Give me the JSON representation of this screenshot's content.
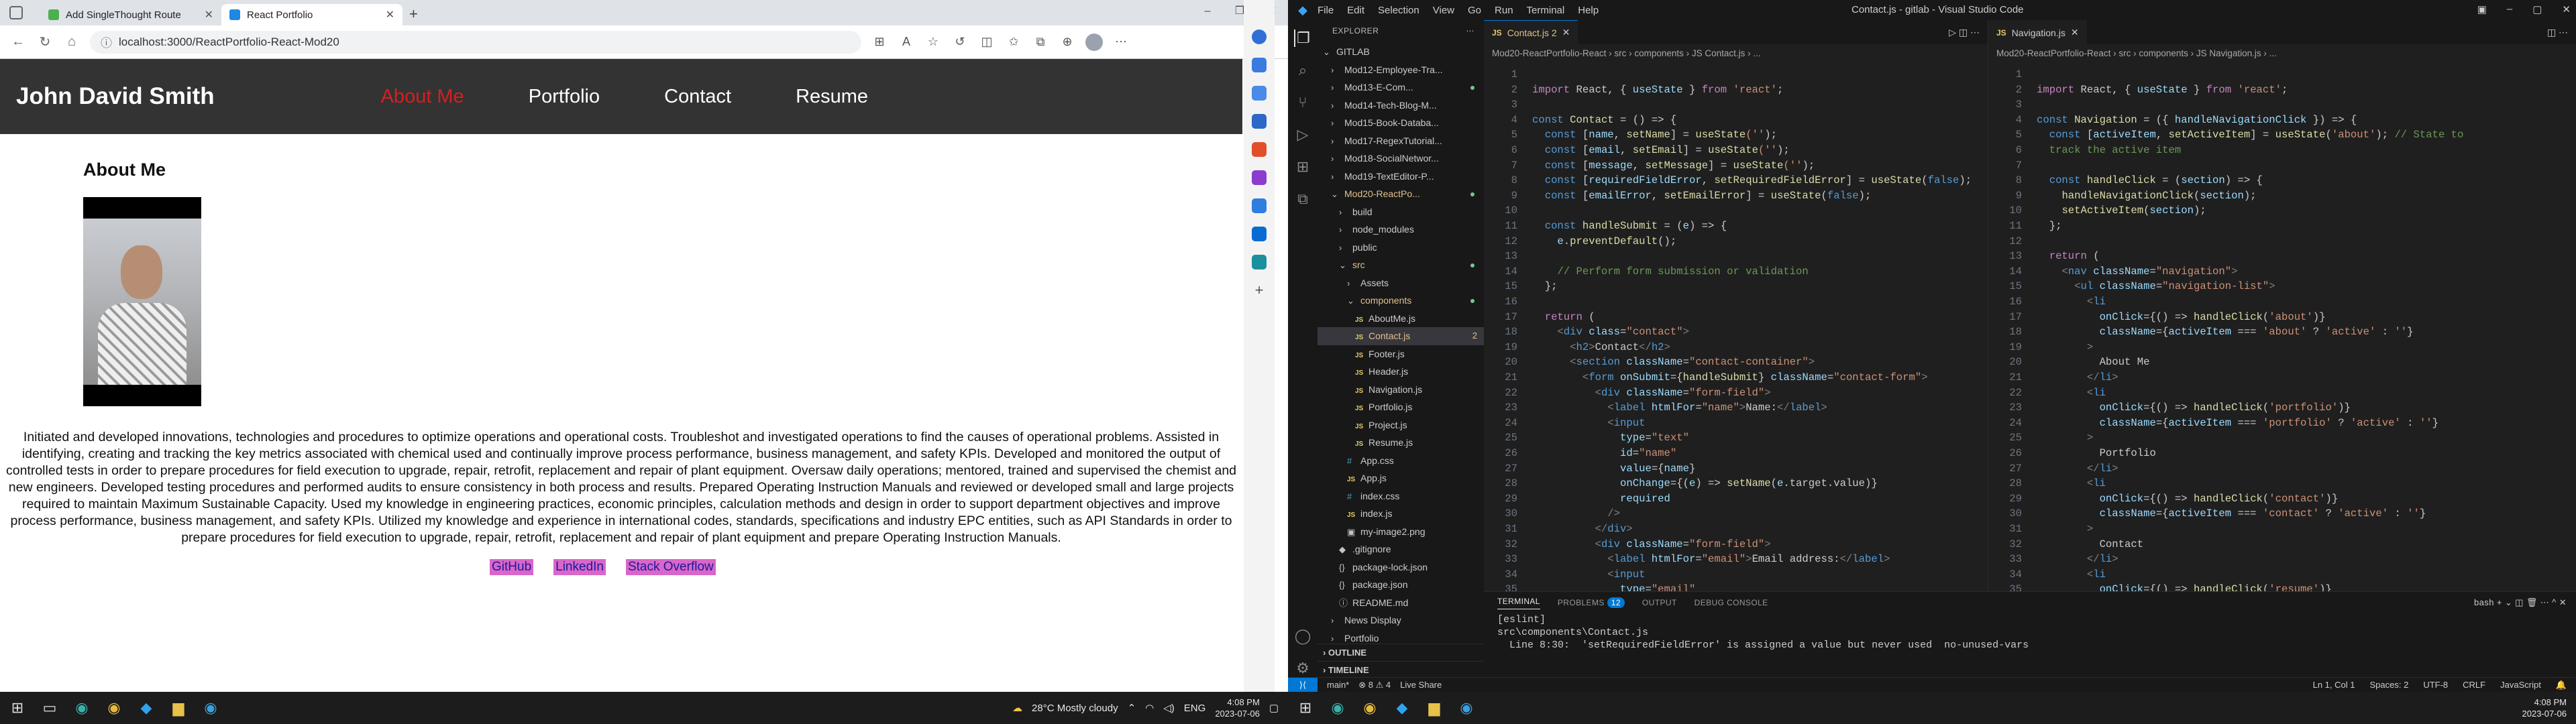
{
  "browser": {
    "tabs": [
      {
        "title": "Add SingleThought Route",
        "favicon_color": "#4caf50"
      },
      {
        "title": "React Portfolio",
        "favicon_color": "#1e88e5"
      }
    ],
    "new_tab": "+",
    "url": "localhost:3000/ReactPortfolio-React-Mod20",
    "win_controls": [
      "–",
      "❐",
      "✕"
    ]
  },
  "site": {
    "name": "John David Smith",
    "nav": [
      "About Me",
      "Portfolio",
      "Contact",
      "Resume"
    ],
    "active_nav": "About Me",
    "section_title": "About Me",
    "bio": "Initiated and developed innovations, technologies and procedures to optimize operations and operational costs. Troubleshot and investigated operations to find the causes of operational problems. Assisted in identifying, creating and tracking the key metrics associated with chemical used and continually improve process performance, business management, and safety KPIs. Developed and monitored the output of controlled tests in order to prepare procedures for field execution to upgrade, repair, retrofit, replacement and repair of plant equipment. Oversaw daily operations; mentored, trained and supervised the chemist and new engineers. Developed testing procedures and performed audits to ensure consistency in both process and results. Prepared Operating Instruction Manuals and reviewed or developed small and large projects required to maintain Maximum Sustainable Capacity. Used my knowledge in engineering practices, economic principles, calculation methods and design in order to support department objectives and improve process performance, business management, and safety KPIs. Utilized my knowledge and experience in international codes, standards, specifications and industry EPC entities, such as API Standards in order to prepare procedures for field execution to upgrade, repair, retrofit, replacement and repair of plant equipment and prepare Operating Instruction Manuals.",
    "links": [
      "GitHub",
      "LinkedIn",
      "Stack Overflow"
    ],
    "link_bg": "#d966c9",
    "nav_active_color": "#d61f1f"
  },
  "taskbar_left": {
    "weather": "28°C  Mostly cloudy",
    "lang": "ENG",
    "time": "4:08 PM",
    "date": "2023-07-06"
  },
  "vscode": {
    "window_title": "Contact.js - gitlab - Visual Studio Code",
    "menu": [
      "File",
      "Edit",
      "Selection",
      "View",
      "Go",
      "Run",
      "Terminal",
      "Help"
    ],
    "explorer_title": "EXPLORER",
    "tree": [
      {
        "label": "GITLAB",
        "indent": 0,
        "arrow": "⌄"
      },
      {
        "label": "Mod12-Employee-Tra...",
        "indent": 1,
        "arrow": "›"
      },
      {
        "label": "Mod13-E-Com...",
        "indent": 1,
        "arrow": "›",
        "dot": true
      },
      {
        "label": "Mod14-Tech-Blog-M...",
        "indent": 1,
        "arrow": "›"
      },
      {
        "label": "Mod15-Book-Databa...",
        "indent": 1,
        "arrow": "›"
      },
      {
        "label": "Mod17-RegexTutorial...",
        "indent": 1,
        "arrow": "›"
      },
      {
        "label": "Mod18-SocialNetwor...",
        "indent": 1,
        "arrow": "›"
      },
      {
        "label": "Mod19-TextEditor-P...",
        "indent": 1,
        "arrow": "›"
      },
      {
        "label": "Mod20-ReactPo...",
        "indent": 1,
        "arrow": "⌄",
        "mod": true,
        "dot": true
      },
      {
        "label": "build",
        "indent": 2,
        "arrow": "›"
      },
      {
        "label": "node_modules",
        "indent": 2,
        "arrow": "›"
      },
      {
        "label": "public",
        "indent": 2,
        "arrow": "›"
      },
      {
        "label": "src",
        "indent": 2,
        "arrow": "⌄",
        "mod": true,
        "dot": true
      },
      {
        "label": "Assets",
        "indent": 3,
        "arrow": "›"
      },
      {
        "label": "components",
        "indent": 3,
        "arrow": "⌄",
        "mod": true,
        "dot": true
      },
      {
        "label": "AboutMe.js",
        "indent": 4,
        "icon": "JS"
      },
      {
        "label": "Contact.js",
        "indent": 4,
        "icon": "JS",
        "sel": true,
        "mod": true,
        "badge": "2"
      },
      {
        "label": "Footer.js",
        "indent": 4,
        "icon": "JS"
      },
      {
        "label": "Header.js",
        "indent": 4,
        "icon": "JS"
      },
      {
        "label": "Navigation.js",
        "indent": 4,
        "icon": "JS"
      },
      {
        "label": "Portfolio.js",
        "indent": 4,
        "icon": "JS"
      },
      {
        "label": "Project.js",
        "indent": 4,
        "icon": "JS"
      },
      {
        "label": "Resume.js",
        "indent": 4,
        "icon": "JS"
      },
      {
        "label": "App.css",
        "indent": 3,
        "icon": "#"
      },
      {
        "label": "App.js",
        "indent": 3,
        "icon": "JS"
      },
      {
        "label": "index.css",
        "indent": 3,
        "icon": "#"
      },
      {
        "label": "index.js",
        "indent": 3,
        "icon": "JS"
      },
      {
        "label": "my-image2.png",
        "indent": 3,
        "icon": "▣"
      },
      {
        "label": ".gitignore",
        "indent": 2,
        "icon": "◆"
      },
      {
        "label": "package-lock.json",
        "indent": 2,
        "icon": "{}"
      },
      {
        "label": "package.json",
        "indent": 2,
        "icon": "{}"
      },
      {
        "label": "README.md",
        "indent": 2,
        "icon": "ⓘ"
      },
      {
        "label": "News Display",
        "indent": 1,
        "arrow": "›"
      },
      {
        "label": "Portfolio",
        "indent": 1,
        "arrow": "›"
      }
    ],
    "outline_label": "OUTLINE",
    "timeline_label": "TIMELINE",
    "editor1": {
      "tab": "Contact.js 2",
      "crumb": "Mod20-ReactPortfolio-React › src › components › JS Contact.js › ..."
    },
    "editor2": {
      "tab": "Navigation.js",
      "crumb": "Mod20-ReactPortfolio-React › src › components › JS Navigation.js › ..."
    },
    "panel_tabs": [
      "TERMINAL",
      "PROBLEMS",
      "OUTPUT",
      "DEBUG CONSOLE"
    ],
    "problems_count": "12",
    "shell": "bash",
    "terminal_lines": [
      "[eslint]",
      "src\\components\\Contact.js",
      "  Line 8:30:  'setRequiredFieldError' is assigned a value but never used  no-unused-vars"
    ],
    "status": {
      "branch": "main*",
      "problems": "⊗ 8  ⚠ 4",
      "live": "Live Share",
      "position": "Ln 1, Col 1",
      "spaces": "Spaces: 2",
      "encoding": "UTF-8",
      "eol": "CRLF",
      "lang": "JavaScript"
    },
    "time": "4:08 PM",
    "date": "2023-07-06"
  }
}
